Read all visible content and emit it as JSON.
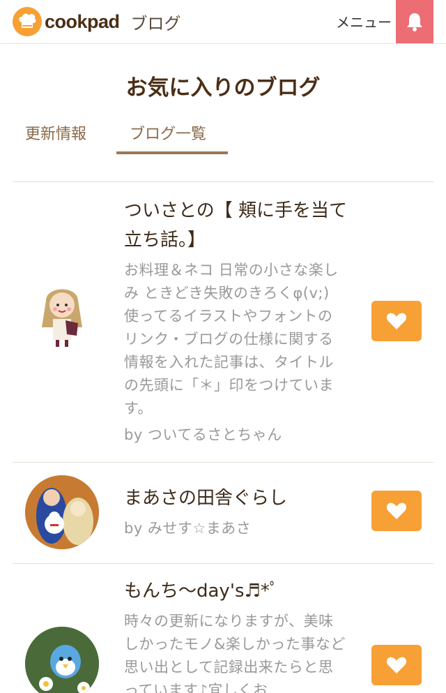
{
  "header": {
    "logo_text": "cookpad",
    "section_label": "ブログ",
    "menu_label": "メニュー",
    "bell_icon": "bell-icon"
  },
  "page": {
    "title": "お気に入りのブログ"
  },
  "tabs": [
    {
      "label": "更新情報",
      "active": false
    },
    {
      "label": "ブログ一覧",
      "active": true
    }
  ],
  "blogs": [
    {
      "title": "ついさとの【 頬に手を当て立ち話。】",
      "description": "お料理＆ネコ 日常の小さな楽しみ ときどき失敗のきろくφ(v;) 使ってるイラストやフォントのリンク・ブログの仕様に関する情報を入れた記事は、タイトルの先頭に「＊」印をつけています。",
      "author": "by ついてるさとちゃん",
      "favorite_icon": "heart-icon"
    },
    {
      "title": "まあさの田舎ぐらし",
      "description": "",
      "author": "by みせす☆まあさ",
      "favorite_icon": "heart-icon"
    },
    {
      "title": "もんち〜day's♬*ﾟ",
      "description": "時々の更新になりますが、美味しかったモノ&楽しかった事など思い出として記録出来たらと思っています♪宜しくお",
      "author": "",
      "favorite_icon": "heart-icon"
    }
  ],
  "colors": {
    "accent_orange": "#f6a036",
    "bell_pink": "#ec6d74",
    "brown_title": "#4b2e15",
    "tab_brown": "#8a6a4a"
  }
}
